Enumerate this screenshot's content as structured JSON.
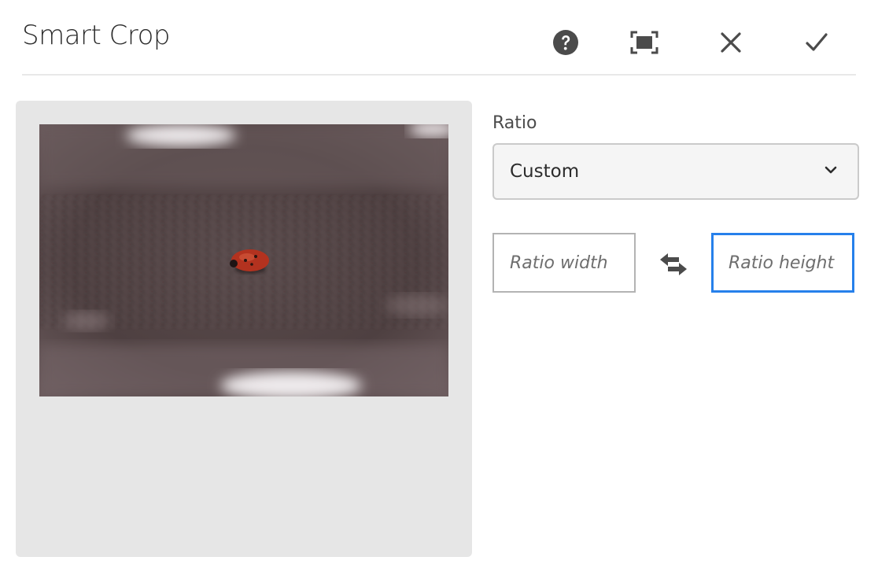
{
  "dialog": {
    "title": "Smart Crop",
    "toolbar": {
      "help_icon": "help-icon",
      "fullscreen_icon": "fullscreen-icon",
      "close_icon": "close-icon",
      "confirm_icon": "checkmark-icon"
    }
  },
  "ratio": {
    "label": "Ratio",
    "selected": "Custom",
    "width_placeholder": "Ratio width",
    "height_placeholder": "Ratio height",
    "swap_icon": "swap-icon"
  },
  "colors": {
    "accent": "#2680eb",
    "panel": "#e6e6e6",
    "icon": "#4b4b4b"
  }
}
